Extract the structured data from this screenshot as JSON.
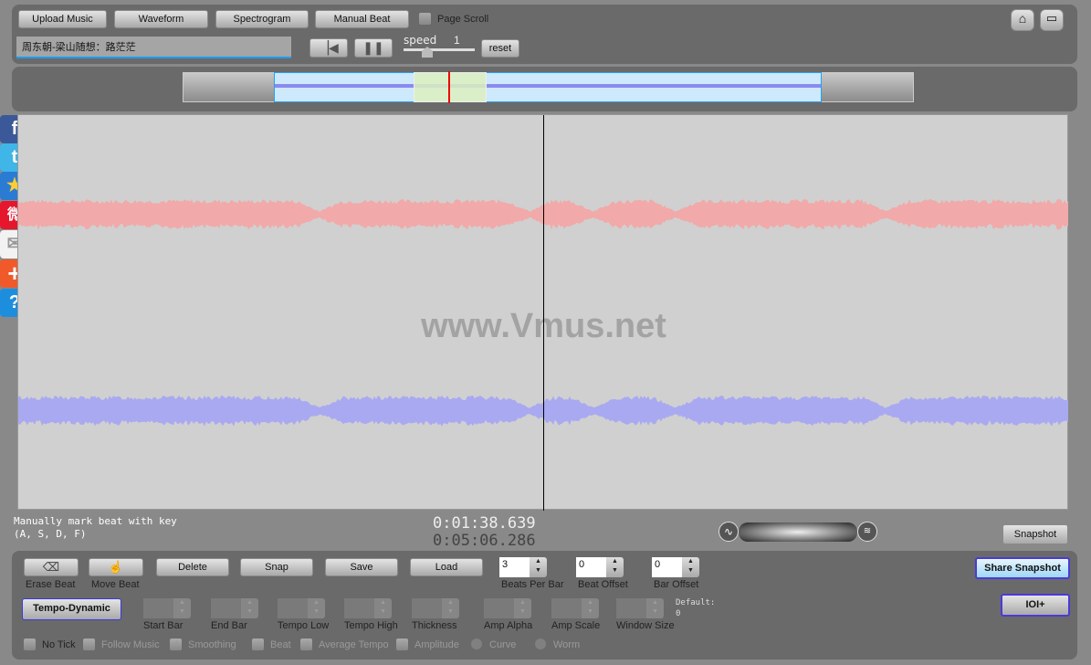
{
  "toolbar": {
    "upload": "Upload Music",
    "waveform": "Waveform",
    "spectrogram": "Spectrogram",
    "manual_beat": "Manual Beat",
    "page_scroll": "Page Scroll",
    "song_title": "周东朝-梁山随想：路茫茫",
    "speed_label": "speed",
    "speed_value": "1",
    "reset": "reset"
  },
  "main": {
    "watermark": "www.Vmus.net",
    "colors": {
      "left_channel": "#f2a9a9",
      "right_channel": "#a9a9f2",
      "canvas": "#d0d0d0"
    }
  },
  "status": {
    "hint_line1": "Manually mark beat with key",
    "hint_line2": "(A, S, D, F)",
    "current_time": "0:01:38.639",
    "total_time": "0:05:06.286",
    "snapshot": "Snapshot"
  },
  "beat_tools": {
    "erase": "Erase Beat",
    "move": "Move Beat",
    "delete": "Delete",
    "snap": "Snap",
    "save": "Save",
    "load": "Load",
    "beats_per_bar_label": "Beats Per Bar",
    "beats_per_bar": "3",
    "beat_offset_label": "Beat Offset",
    "beat_offset": "0",
    "bar_offset_label": "Bar Offset",
    "bar_offset": "0",
    "share_snapshot": "Share Snapshot",
    "ioi": "IOI+"
  },
  "tempo": {
    "button": "Tempo-Dynamic",
    "fields": [
      "Start Bar",
      "End Bar",
      "Tempo Low",
      "Tempo High",
      "Thickness",
      "Amp Alpha",
      "Amp Scale",
      "Window Size"
    ],
    "default_label": "Default:",
    "default_value": "0"
  },
  "options": [
    {
      "label": "No Tick",
      "checked": false
    },
    {
      "label": "Follow Music",
      "checked": false
    },
    {
      "label": "Smoothing",
      "checked": true
    },
    {
      "label": "Beat",
      "checked": true
    },
    {
      "label": "Average Tempo",
      "checked": true
    },
    {
      "label": "Amplitude",
      "checked": true
    },
    {
      "label": "Curve",
      "type": "radio"
    },
    {
      "label": "Worm",
      "type": "radio"
    }
  ],
  "social": [
    "facebook-icon",
    "twitter-icon",
    "favorite-icon",
    "weibo-icon",
    "email-icon",
    "add-icon",
    "help-icon"
  ]
}
